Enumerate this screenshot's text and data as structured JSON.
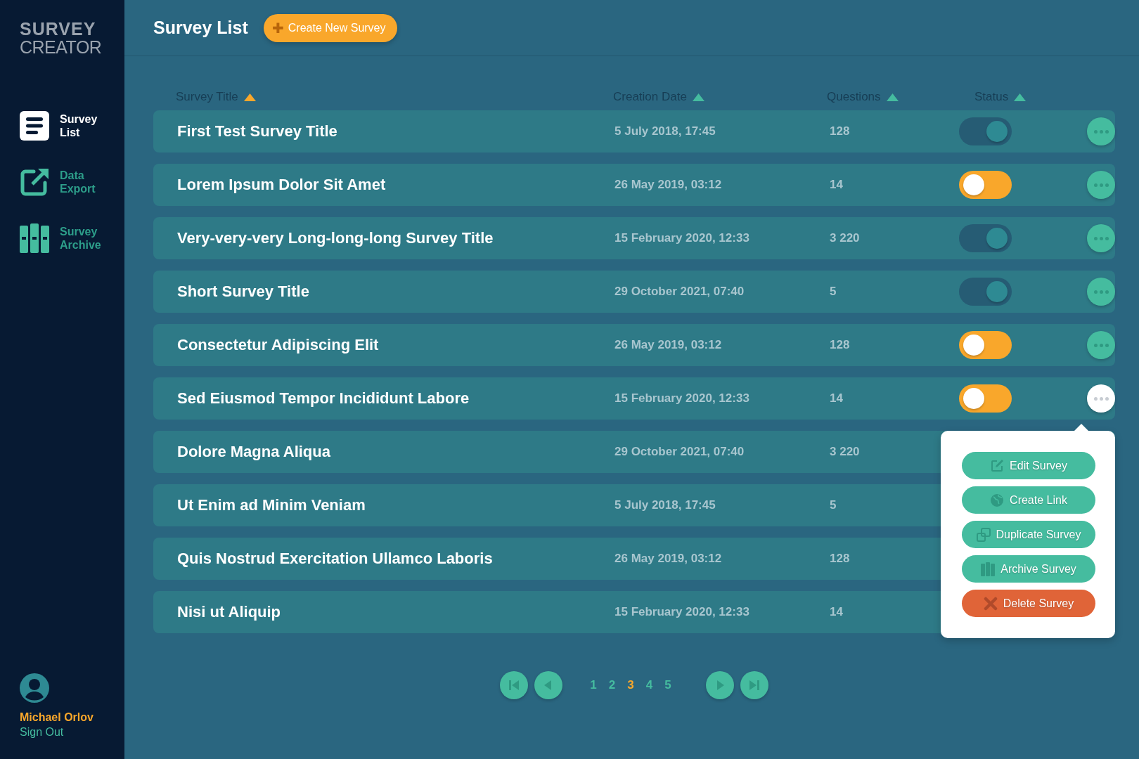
{
  "logo": {
    "line_1": "SURVEY",
    "line_2": "CREATOR"
  },
  "sidebar": {
    "items": [
      {
        "kind": "list",
        "label_1": "Survey",
        "label_2": "List",
        "selected": true
      },
      {
        "kind": "export",
        "label_1": "Data",
        "label_2": "Export",
        "selected": false
      },
      {
        "kind": "archive",
        "label_1": "Survey",
        "label_2": "Archive",
        "selected": false
      }
    ],
    "user": {
      "name": "Michael Orlov",
      "sign_out": "Sign Out"
    }
  },
  "header": {
    "title": "Survey List",
    "create_button": {
      "icon": "✚",
      "label": "Create New Survey"
    }
  },
  "table": {
    "columns": [
      {
        "label": "Survey Title",
        "sorted": true
      },
      {
        "label": "Creation Date",
        "sorted": false
      },
      {
        "label": "Questions",
        "sorted": false
      },
      {
        "label": "Status",
        "sorted": false
      }
    ],
    "rows": [
      {
        "title": "First Test Survey Title",
        "date": "5 July 2018, 17:45",
        "questions": "128",
        "on": true,
        "menu_open": false
      },
      {
        "title": "Lorem Ipsum Dolor Sit Amet",
        "date": "26 May 2019, 03:12",
        "questions": "14",
        "on": false,
        "menu_open": false
      },
      {
        "title": "Very-very-very Long-long-long Survey Title",
        "date": "15 February 2020, 12:33",
        "questions": "3 220",
        "on": true,
        "menu_open": false
      },
      {
        "title": "Short Survey Title",
        "date": "29 October 2021, 07:40",
        "questions": "5",
        "on": true,
        "menu_open": false
      },
      {
        "title": "Consectetur Adipiscing Elit",
        "date": "26 May 2019, 03:12",
        "questions": "128",
        "on": false,
        "menu_open": false
      },
      {
        "title": "Sed Eiusmod Tempor Incididunt Labore",
        "date": "15 February 2020, 12:33",
        "questions": "14",
        "on": false,
        "menu_open": true
      },
      {
        "title": "Dolore Magna Aliqua",
        "date": "29 October 2021, 07:40",
        "questions": "3 220"
      },
      {
        "title": "Ut Enim ad Minim Veniam",
        "date": "5 July 2018, 17:45",
        "questions": "5"
      },
      {
        "title": "Quis Nostrud Exercitation Ullamco Laboris",
        "date": "26 May 2019, 03:12",
        "questions": "128"
      },
      {
        "title": "Nisi ut Aliquip",
        "date": "15 February 2020, 12:33",
        "questions": "14"
      }
    ]
  },
  "context_menu": {
    "items": [
      {
        "kind": "edit",
        "label": "Edit Survey"
      },
      {
        "kind": "link",
        "label": "Create Link"
      },
      {
        "kind": "duplicate",
        "label": "Duplicate Survey"
      },
      {
        "kind": "archive",
        "label": "Archive Survey"
      },
      {
        "kind": "delete",
        "label": "Delete Survey"
      }
    ]
  },
  "pagination": {
    "pages": [
      {
        "label": "1",
        "selected": false
      },
      {
        "label": "2",
        "selected": false
      },
      {
        "label": "3",
        "selected": true
      },
      {
        "label": "4",
        "selected": false
      },
      {
        "label": "5",
        "selected": false
      }
    ]
  }
}
